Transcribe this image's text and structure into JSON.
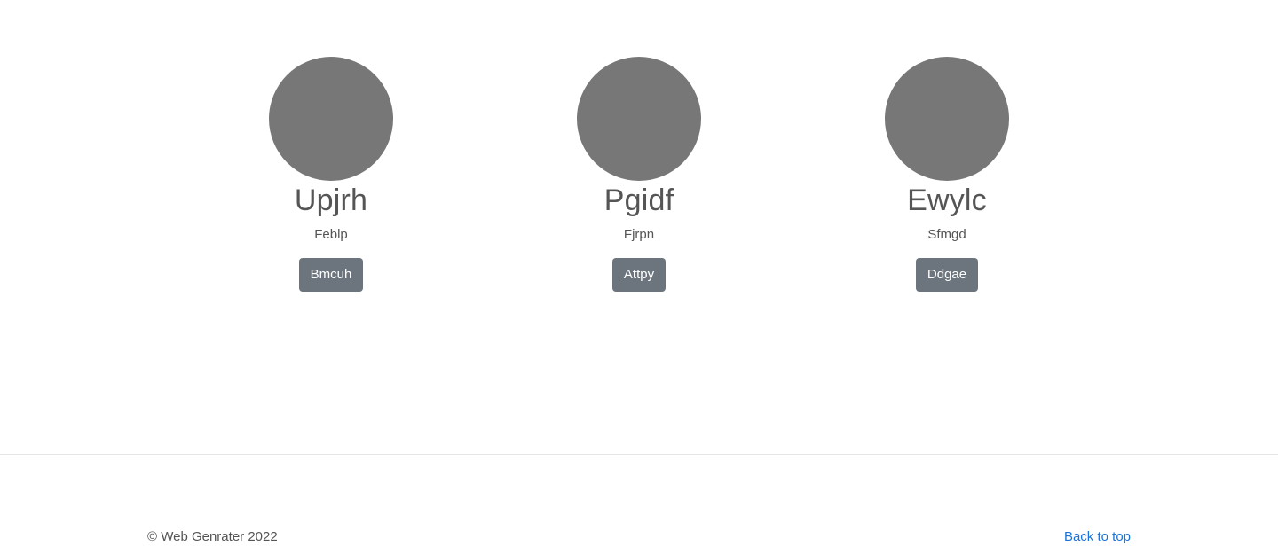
{
  "cards": [
    {
      "title": "Upjrh",
      "subtitle": "Feblp",
      "button_label": "Bmcuh"
    },
    {
      "title": "Pgidf",
      "subtitle": "Fjrpn",
      "button_label": "Attpy"
    },
    {
      "title": "Ewylc",
      "subtitle": "Sfmgd",
      "button_label": "Ddgae"
    }
  ],
  "footer": {
    "copyright": "© Web Genrater 2022",
    "back_to_top": "Back to top"
  },
  "colors": {
    "avatar": "#777777",
    "button_bg": "#6c757d",
    "link": "#1a73d9",
    "text": "#555555"
  }
}
